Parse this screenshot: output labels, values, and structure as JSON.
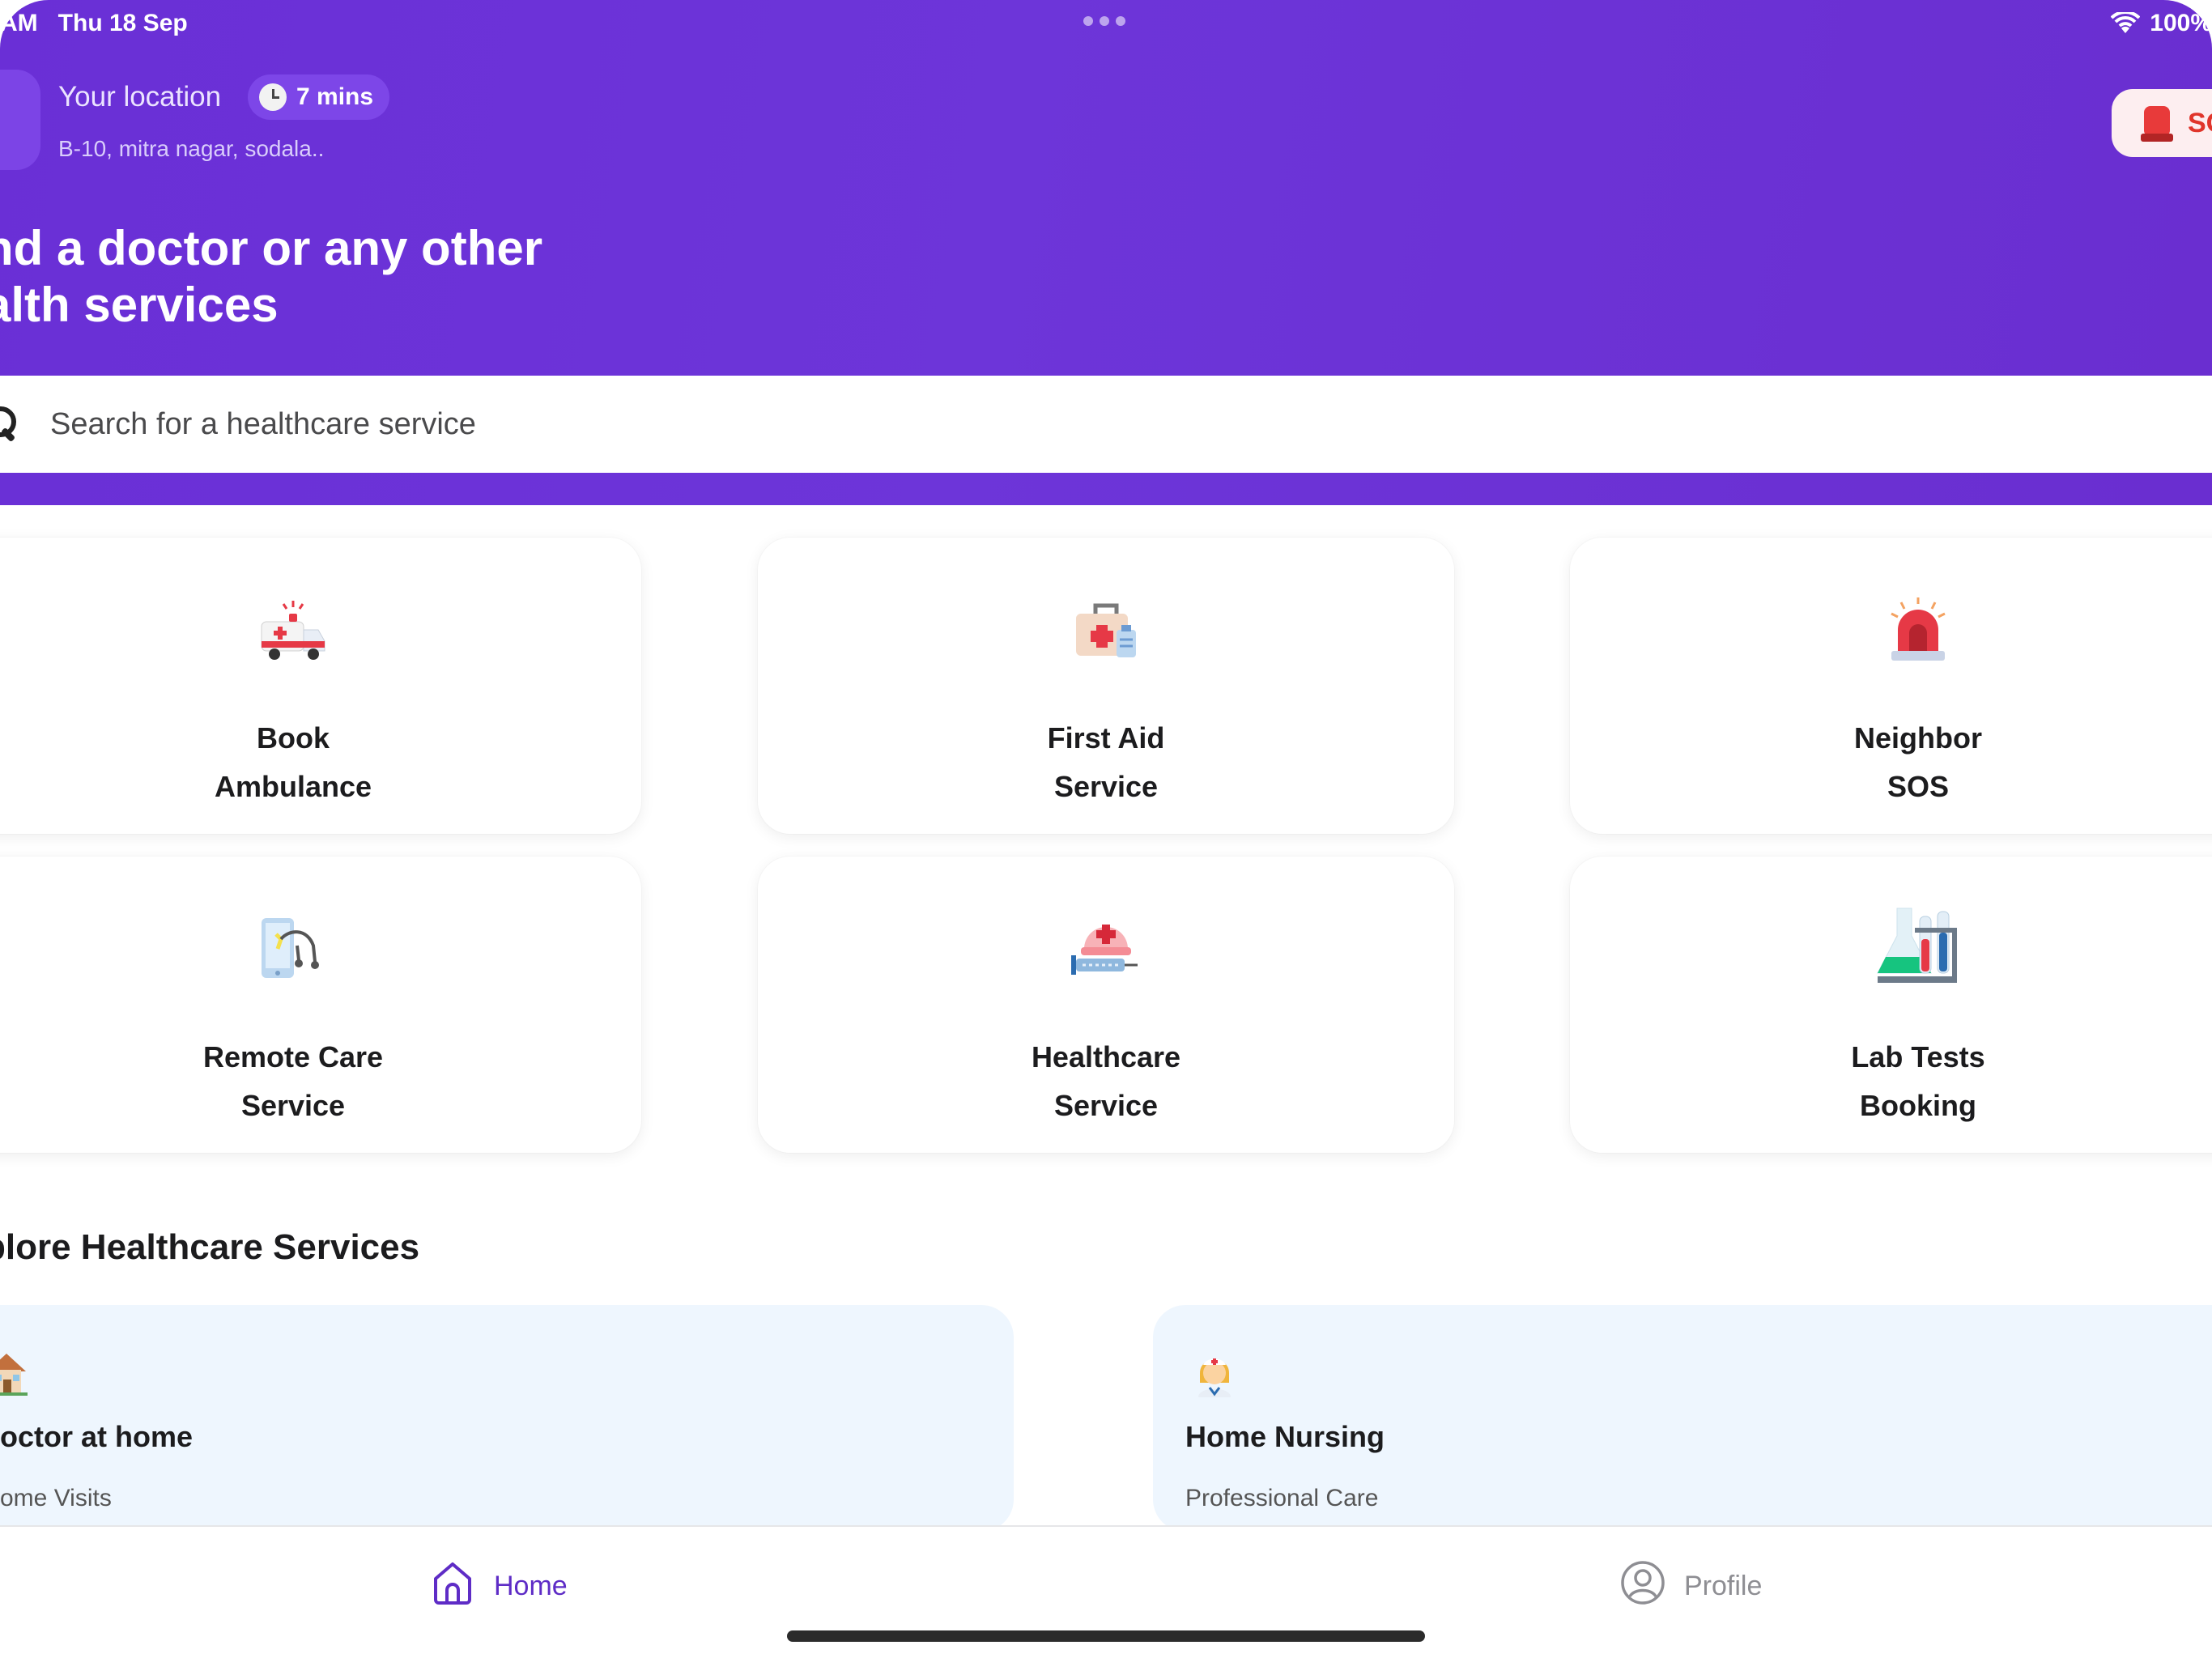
{
  "status_bar": {
    "time": "AM",
    "date": "Thu 18 Sep",
    "battery": "100%"
  },
  "header": {
    "location_label": "Your location",
    "eta": "7 mins",
    "address": "B-10, mitra nagar, sodala..",
    "sos_label": "SOS",
    "title_line1": "nd a doctor or any other",
    "title_line2": "alth services"
  },
  "search": {
    "placeholder": "Search for a healthcare service"
  },
  "services": [
    {
      "line1": "Book",
      "line2": "Ambulance",
      "icon": "ambulance-icon"
    },
    {
      "line1": "First Aid",
      "line2": "Service",
      "icon": "first-aid-kit-icon"
    },
    {
      "line1": "Neighbor",
      "line2": "SOS",
      "icon": "siren-icon"
    },
    {
      "line1": "Remote Care",
      "line2": "Service",
      "icon": "remote-care-icon"
    },
    {
      "line1": "Healthcare",
      "line2": "Service",
      "icon": "nurse-syringe-icon"
    },
    {
      "line1": "Lab Tests",
      "line2": "Booking",
      "icon": "lab-flask-icon"
    }
  ],
  "explore": {
    "title": "plore Healthcare Services",
    "items": [
      {
        "title": "octor at home",
        "subtitle": "ome Visits",
        "icon": "house-icon"
      },
      {
        "title": "Home Nursing",
        "subtitle": "Professional Care",
        "icon": "nurse-icon"
      }
    ]
  },
  "tabs": {
    "home": "Home",
    "profile": "Profile"
  },
  "colors": {
    "primary": "#6a2fd6",
    "sos_red": "#e0352b",
    "explore_bg": "#eef6fe",
    "tab_active": "#5e2cc6",
    "tab_inactive": "#8e8e93"
  }
}
